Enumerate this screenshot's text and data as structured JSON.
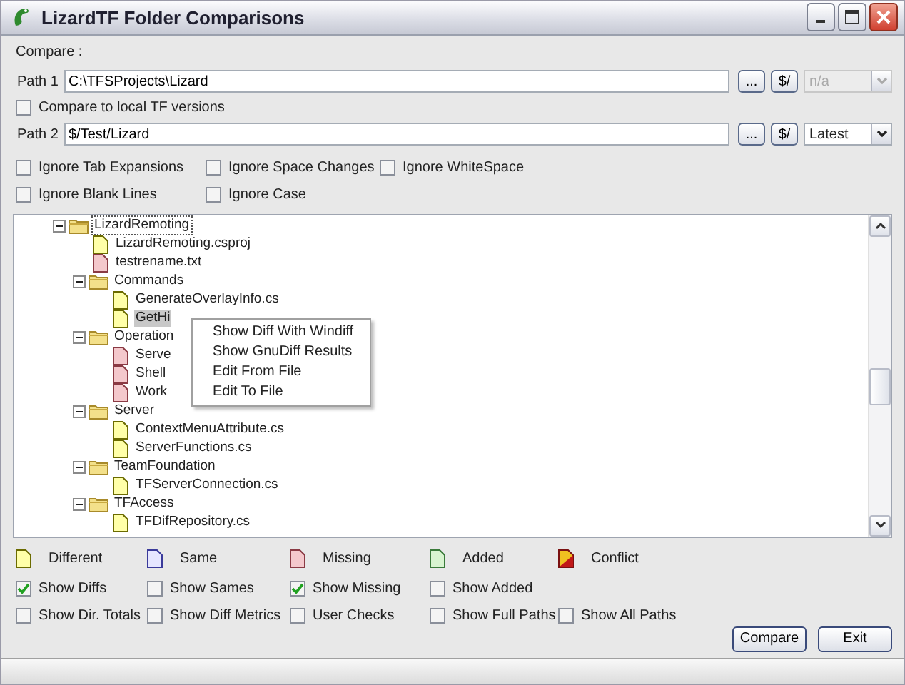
{
  "window": {
    "title": "LizardTF Folder Comparisons"
  },
  "compare_label": "Compare :",
  "path1": {
    "label": "Path 1",
    "value": "C:\\TFSProjects\\Lizard",
    "browse": "...",
    "server": "$/",
    "version": "n/a",
    "version_disabled": true
  },
  "local_versions": {
    "label": "Compare to local TF versions",
    "checked": false
  },
  "path2": {
    "label": "Path 2",
    "value": "$/Test/Lizard",
    "browse": "...",
    "server": "$/",
    "version": "Latest",
    "version_disabled": false
  },
  "ignore_options": [
    {
      "label": "Ignore Tab Expansions",
      "checked": false
    },
    {
      "label": "Ignore Space Changes",
      "checked": false
    },
    {
      "label": "Ignore WhiteSpace",
      "checked": false
    },
    {
      "label": "Ignore Blank Lines",
      "checked": false
    },
    {
      "label": "Ignore Case",
      "checked": false
    }
  ],
  "tree": [
    {
      "kind": "folder",
      "name": "LizardRemoting",
      "expanded": true,
      "selected": false,
      "children": [
        {
          "kind": "different",
          "name": "LizardRemoting.csproj",
          "selected": false
        },
        {
          "kind": "missing",
          "name": "testrename.txt",
          "selected": false
        },
        {
          "kind": "folder",
          "name": "Commands",
          "expanded": true,
          "selected": false,
          "children": [
            {
              "kind": "different",
              "name": "GenerateOverlayInfo.cs",
              "selected": false
            },
            {
              "kind": "different",
              "name": "GetHi",
              "selected": true
            }
          ]
        },
        {
          "kind": "folder",
          "name": "Operation",
          "expanded": true,
          "selected": false,
          "children": [
            {
              "kind": "missing",
              "name": "Serve",
              "selected": false
            },
            {
              "kind": "missing",
              "name": "Shell",
              "selected": false
            },
            {
              "kind": "missing",
              "name": "Work",
              "selected": false
            }
          ]
        },
        {
          "kind": "folder",
          "name": "Server",
          "expanded": true,
          "selected": false,
          "children": [
            {
              "kind": "different",
              "name": "ContextMenuAttribute.cs",
              "selected": false
            },
            {
              "kind": "different",
              "name": "ServerFunctions.cs",
              "selected": false
            }
          ]
        },
        {
          "kind": "folder",
          "name": "TeamFoundation",
          "expanded": true,
          "selected": false,
          "children": [
            {
              "kind": "different",
              "name": "TFServerConnection.cs",
              "selected": false
            }
          ]
        },
        {
          "kind": "folder",
          "name": "TFAccess",
          "expanded": true,
          "selected": false,
          "children": [
            {
              "kind": "different",
              "name": "TFDifRepository.cs",
              "selected": false
            }
          ]
        }
      ]
    }
  ],
  "context_menu": [
    "Show Diff With Windiff",
    "Show GnuDiff Results",
    "Edit From File",
    "Edit To File"
  ],
  "legend": [
    {
      "label": "Different",
      "kind": "different"
    },
    {
      "label": "Same",
      "kind": "same"
    },
    {
      "label": "Missing",
      "kind": "missing"
    },
    {
      "label": "Added",
      "kind": "added"
    },
    {
      "label": "Conflict",
      "kind": "conflict"
    }
  ],
  "show_options": [
    [
      {
        "label": "Show Diffs",
        "checked": true
      },
      {
        "label": "Show Sames",
        "checked": false
      },
      {
        "label": "Show Missing",
        "checked": true
      },
      {
        "label": "Show Added",
        "checked": false
      }
    ],
    [
      {
        "label": "Show Dir. Totals",
        "checked": false
      },
      {
        "label": "Show Diff Metrics",
        "checked": false
      },
      {
        "label": "User Checks",
        "checked": false
      },
      {
        "label": "Show Full Paths",
        "checked": false
      },
      {
        "label": "Show All Paths",
        "checked": false
      }
    ]
  ],
  "buttons": [
    "Compare",
    "Exit"
  ]
}
